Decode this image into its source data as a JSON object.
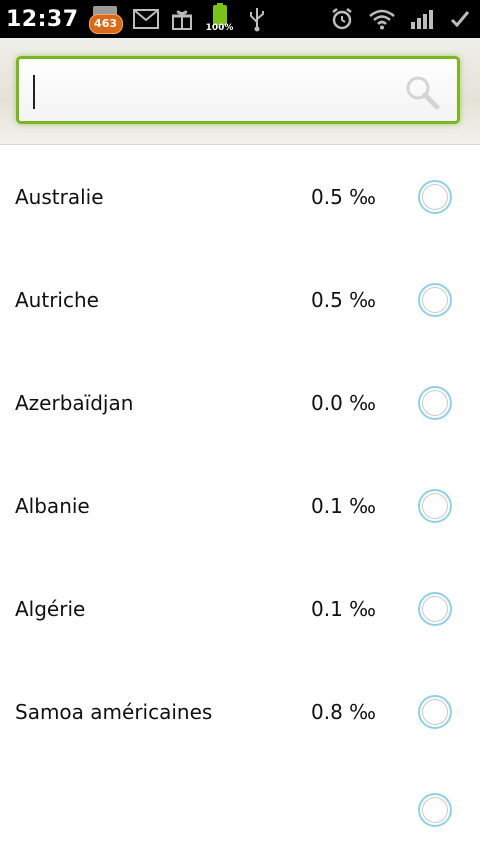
{
  "status_bar": {
    "time": "12:37",
    "mail_badge_count": "463",
    "battery_percent": "100%"
  },
  "search": {
    "placeholder": "",
    "value": ""
  },
  "countries": [
    {
      "name": "Australie",
      "rate": "0.5 ‰"
    },
    {
      "name": "Autriche",
      "rate": "0.5 ‰"
    },
    {
      "name": "Azerbaïdjan",
      "rate": "0.0 ‰"
    },
    {
      "name": "Albanie",
      "rate": "0.1 ‰"
    },
    {
      "name": "Algérie",
      "rate": "0.1 ‰"
    },
    {
      "name": "Samoa américaines",
      "rate": "0.8 ‰"
    }
  ],
  "colors": {
    "accent_green": "#7ab624",
    "radio_ring": "#8fd2e8",
    "badge_orange": "#d96a1a",
    "battery_green": "#7cc11a"
  }
}
